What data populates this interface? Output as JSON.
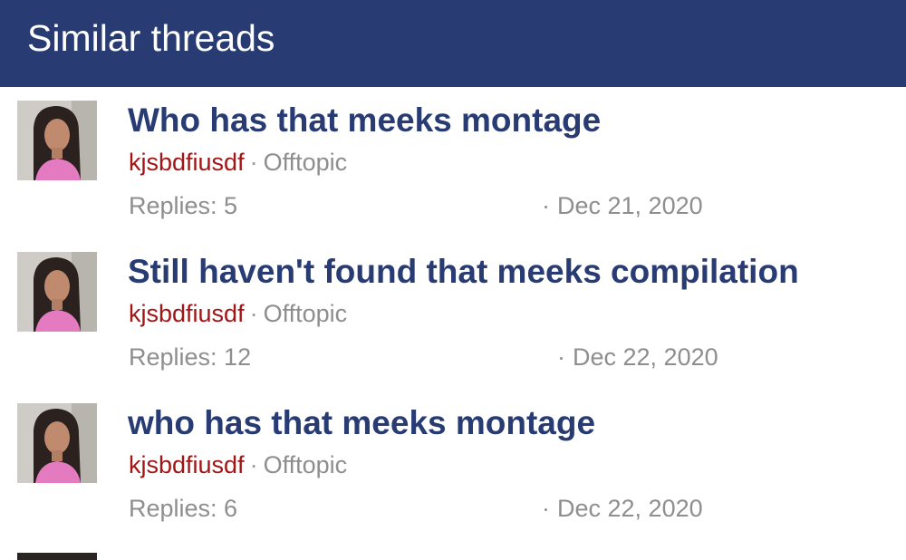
{
  "header": {
    "title": "Similar threads"
  },
  "threads": [
    {
      "title": "Who has that meeks montage",
      "author": "kjsbdfiusdf",
      "separator": "·",
      "forum": "Offtopic",
      "replies": "Replies: 5",
      "date_dot": "·",
      "date": "Dec 21, 2020"
    },
    {
      "title": "Still haven't found that meeks compilation",
      "author": "kjsbdfiusdf",
      "separator": "·",
      "forum": "Offtopic",
      "replies": "Replies: 12",
      "date_dot": "·",
      "date": "Dec 22, 2020"
    },
    {
      "title": "who has that meeks montage",
      "author": "kjsbdfiusdf",
      "separator": "·",
      "forum": "Offtopic",
      "replies": "Replies: 6",
      "date_dot": "·",
      "date": "Dec 22, 2020"
    }
  ],
  "colors": {
    "header_bg": "#283b73",
    "title": "#283b73",
    "author": "#a31515",
    "muted": "#8e8e8e"
  }
}
